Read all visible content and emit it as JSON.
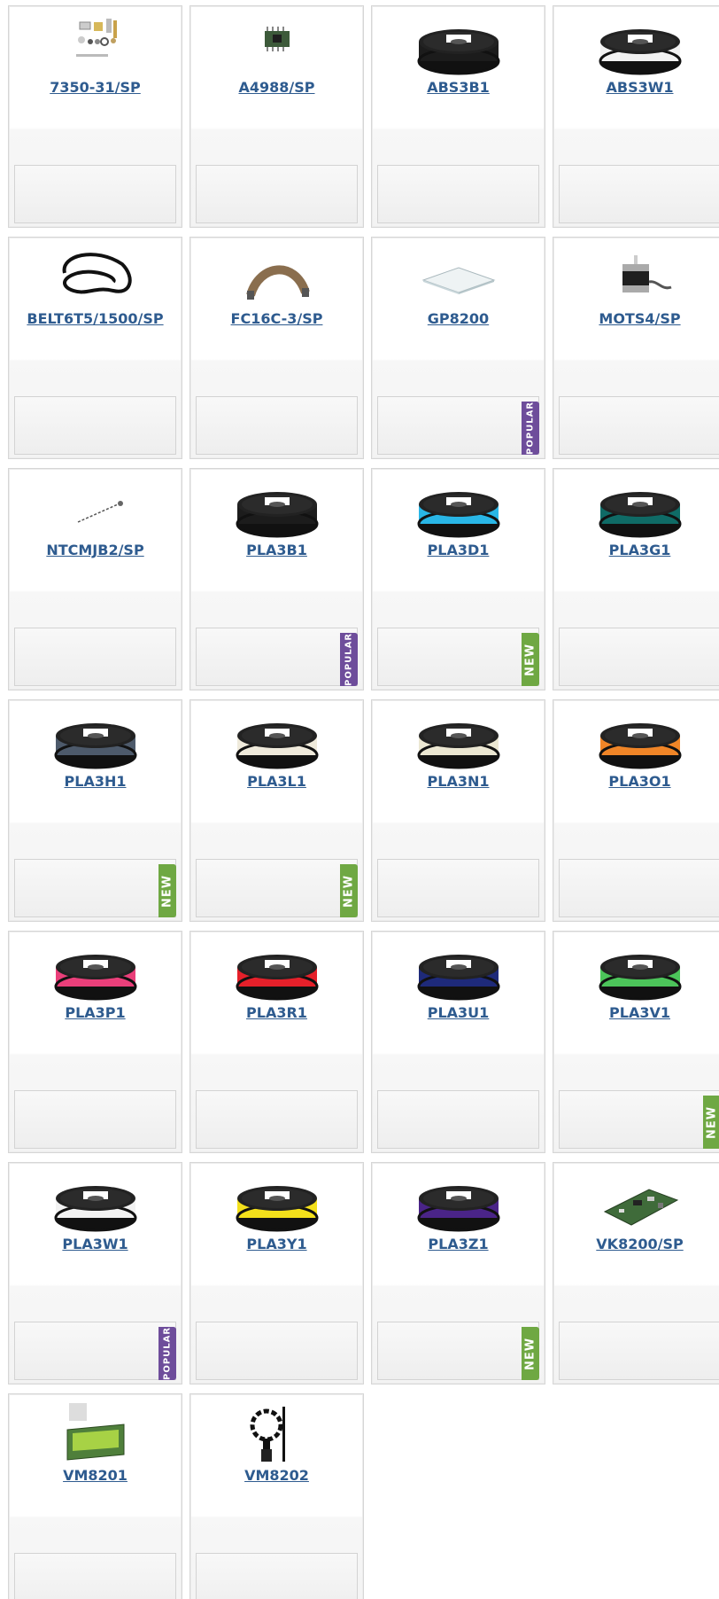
{
  "products": [
    {
      "sku": "7350-31/SP",
      "thumb": "spare-parts-kit",
      "badge": null
    },
    {
      "sku": "A4988/SP",
      "thumb": "driver-chip",
      "badge": null
    },
    {
      "sku": "ABS3B1",
      "thumb": "spool",
      "color": "#1c1c1c",
      "badge": null
    },
    {
      "sku": "ABS3W1",
      "thumb": "spool",
      "color": "#f2f2f2",
      "badge": null
    },
    {
      "sku": "BELT6T5/1500/SP",
      "thumb": "belt",
      "badge": null
    },
    {
      "sku": "FC16C-3/SP",
      "thumb": "flat-cable",
      "badge": null
    },
    {
      "sku": "GP8200",
      "thumb": "glass-plate",
      "badge": "POPULAR"
    },
    {
      "sku": "MOTS4/SP",
      "thumb": "stepper-motor",
      "badge": null
    },
    {
      "sku": "NTCMJB2/SP",
      "thumb": "thermistor",
      "badge": null
    },
    {
      "sku": "PLA3B1",
      "thumb": "spool",
      "color": "#1c1c1c",
      "badge": "POPULAR"
    },
    {
      "sku": "PLA3D1",
      "thumb": "spool",
      "color": "#29b6e6",
      "badge": "NEW"
    },
    {
      "sku": "PLA3G1",
      "thumb": "spool",
      "color": "#0f6b66",
      "badge": null
    },
    {
      "sku": "PLA3H1",
      "thumb": "spool",
      "color": "#4d5a6b",
      "badge": "NEW"
    },
    {
      "sku": "PLA3L1",
      "thumb": "spool",
      "color": "#efeadb",
      "badge": "NEW"
    },
    {
      "sku": "PLA3N1",
      "thumb": "spool",
      "color": "#ebe7d2",
      "badge": null
    },
    {
      "sku": "PLA3O1",
      "thumb": "spool",
      "color": "#f08527",
      "badge": null
    },
    {
      "sku": "PLA3P1",
      "thumb": "spool",
      "color": "#ea3f7a",
      "badge": null
    },
    {
      "sku": "PLA3R1",
      "thumb": "spool",
      "color": "#e5202a",
      "badge": null
    },
    {
      "sku": "PLA3U1",
      "thumb": "spool",
      "color": "#1e2a7a",
      "badge": null
    },
    {
      "sku": "PLA3V1",
      "thumb": "spool",
      "color": "#4cc45a",
      "badge": "NEW"
    },
    {
      "sku": "PLA3W1",
      "thumb": "spool",
      "color": "#f2f2f2",
      "badge": "POPULAR"
    },
    {
      "sku": "PLA3Y1",
      "thumb": "spool",
      "color": "#f3e01b",
      "badge": null
    },
    {
      "sku": "PLA3Z1",
      "thumb": "spool",
      "color": "#4a2488",
      "badge": "NEW"
    },
    {
      "sku": "VK8200/SP",
      "thumb": "circuit-board",
      "badge": null
    },
    {
      "sku": "VM8201",
      "thumb": "lcd-module",
      "badge": null
    },
    {
      "sku": "VM8202",
      "thumb": "sensor-probe",
      "badge": null
    }
  ]
}
